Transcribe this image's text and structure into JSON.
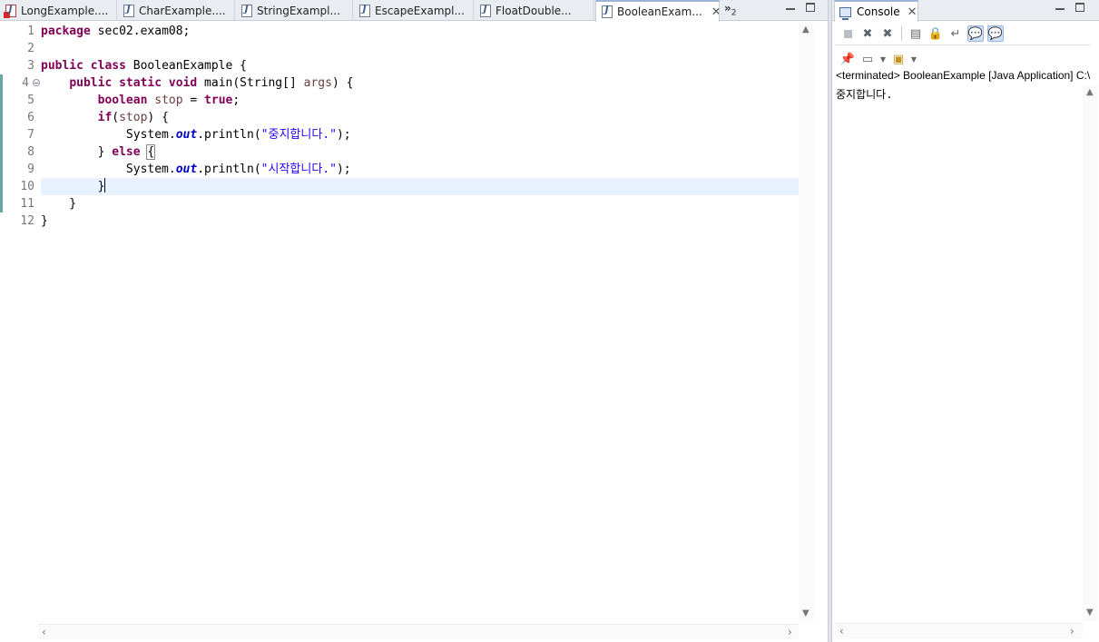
{
  "editor": {
    "tabs": [
      {
        "label": "LongExample....",
        "icon": "java-file-error-icon"
      },
      {
        "label": "CharExample....",
        "icon": "java-file-icon"
      },
      {
        "label": "StringExampl...",
        "icon": "java-file-icon"
      },
      {
        "label": "EscapeExampl...",
        "icon": "java-file-icon"
      },
      {
        "label": "FloatDouble...",
        "icon": "java-file-icon"
      },
      {
        "label": "BooleanExam...",
        "icon": "java-file-icon",
        "active": true
      }
    ],
    "overflow_label": "»",
    "overflow_count": "2",
    "line_numbers": [
      "1",
      "2",
      "3",
      "4",
      "5",
      "6",
      "7",
      "8",
      "9",
      "10",
      "11",
      "12"
    ],
    "current_line": 10,
    "code_lines": [
      "package sec02.exam08;",
      "",
      "public class BooleanExample {",
      "    public static void main(String[] args) {",
      "        boolean stop = true;",
      "        if(stop) {",
      "            System.out.println(\"중지합니다.\");",
      "        } else {",
      "            System.out.println(\"시작합니다.\");",
      "        }",
      "    }",
      "}"
    ]
  },
  "console": {
    "tab_label": "Console",
    "process_label": "<terminated> BooleanExample [Java Application] C:\\",
    "output": "중지합니다."
  },
  "colors": {
    "keyword": "#7f0055",
    "string": "#2a00ff",
    "field": "#0000c0",
    "local_var": "#6a3e3e",
    "current_line_bg": "#e8f2fe"
  }
}
